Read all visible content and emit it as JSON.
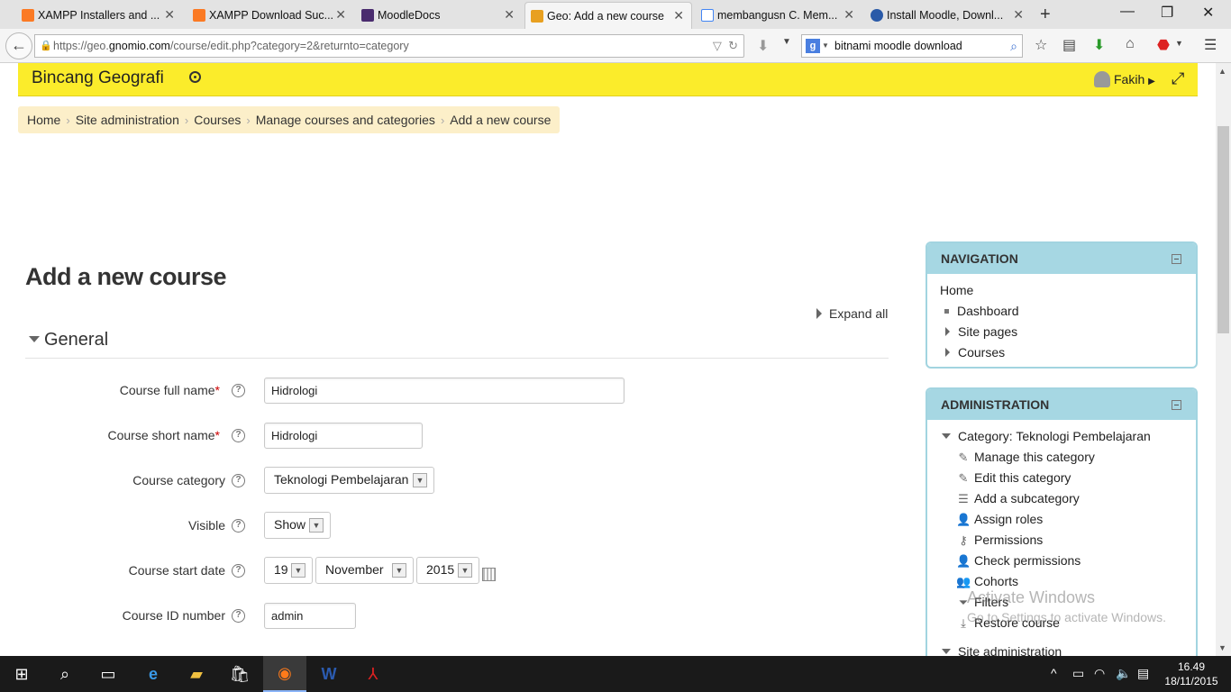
{
  "browser": {
    "tabs": [
      {
        "label": "XAMPP Installers and ...",
        "fav_color": "#fb7a24"
      },
      {
        "label": "XAMPP Download Suc...",
        "fav_color": "#fb7a24"
      },
      {
        "label": "MoodleDocs",
        "fav_color": "#4a2c6e"
      },
      {
        "label": "Geo: Add a new course",
        "fav_color": "#e8a020"
      },
      {
        "label": "membangusn C. Mem...",
        "fav_color": "#4285f4"
      },
      {
        "label": "Install Moodle, Downl...",
        "fav_color": "#2a5aa8"
      }
    ],
    "url_prefix": "https://geo.",
    "url_domain": "gnomio.com",
    "url_suffix": "/course/edit.php?category=2&returnto=category",
    "search_value": "bitnami moodle download"
  },
  "header": {
    "site_name": "Bincang Geografi",
    "user_name": "Fakih"
  },
  "breadcrumb": [
    "Home",
    "Site administration",
    "Courses",
    "Manage courses and categories",
    "Add a new course"
  ],
  "page": {
    "title": "Add a new course",
    "expand_all": "Expand all",
    "section": "General"
  },
  "form": {
    "fullname": {
      "label": "Course full name",
      "value": "Hidrologi"
    },
    "shortname": {
      "label": "Course short name",
      "value": "Hidrologi"
    },
    "category": {
      "label": "Course category",
      "value": "Teknologi Pembelajaran"
    },
    "visible": {
      "label": "Visible",
      "value": "Show"
    },
    "startdate": {
      "label": "Course start date",
      "day": "19",
      "month": "November",
      "year": "2015"
    },
    "idnumber": {
      "label": "Course ID number",
      "value": "admin"
    },
    "required_mark": "*",
    "help_mark": "?"
  },
  "navigation": {
    "title": "NAVIGATION",
    "home": "Home",
    "items": [
      "Dashboard",
      "Site pages",
      "Courses"
    ]
  },
  "administration": {
    "title": "ADMINISTRATION",
    "category": "Category: Teknologi Pembelajaran",
    "items": [
      "Manage this category",
      "Edit this category",
      "Add a subcategory",
      "Assign roles",
      "Permissions",
      "Check permissions",
      "Cohorts",
      "Filters",
      "Restore course"
    ],
    "site_admin": "Site administration"
  },
  "watermark": {
    "line1": "Activate Windows",
    "line2": "Go to Settings to activate Windows."
  },
  "taskbar": {
    "time": "16.49",
    "date": "18/11/2015"
  }
}
